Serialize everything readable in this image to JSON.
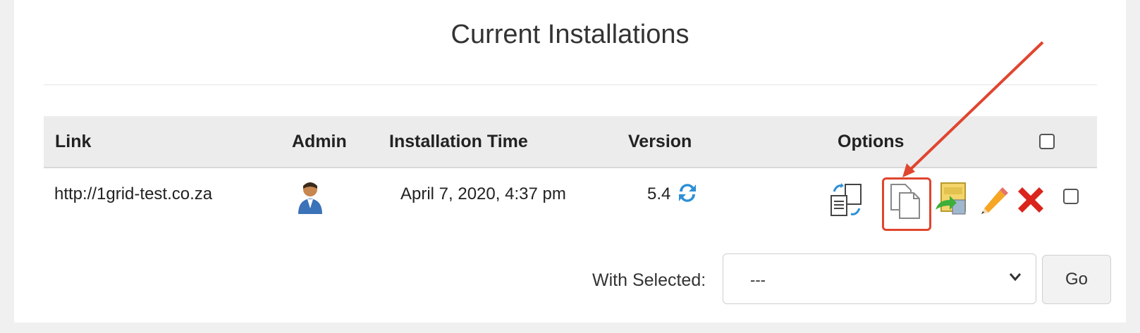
{
  "section": {
    "title": "Current Installations"
  },
  "table": {
    "headers": {
      "link": "Link",
      "admin": "Admin",
      "time": "Installation Time",
      "version": "Version",
      "options": "Options"
    },
    "rows": [
      {
        "link": "http://1grid-test.co.za",
        "installation_time": "April 7, 2020, 4:37 pm",
        "version": "5.4"
      }
    ]
  },
  "options_icons": [
    "backup-restore-icon",
    "clone-icon",
    "staging-icon",
    "edit-icon",
    "remove-icon"
  ],
  "bulk": {
    "label": "With Selected:",
    "selected": "---",
    "go_label": "Go"
  },
  "colors": {
    "annotation": "#e0452f",
    "update_icon": "#2e8fd6",
    "remove": "#d9251c",
    "header_bg": "#ececec"
  }
}
